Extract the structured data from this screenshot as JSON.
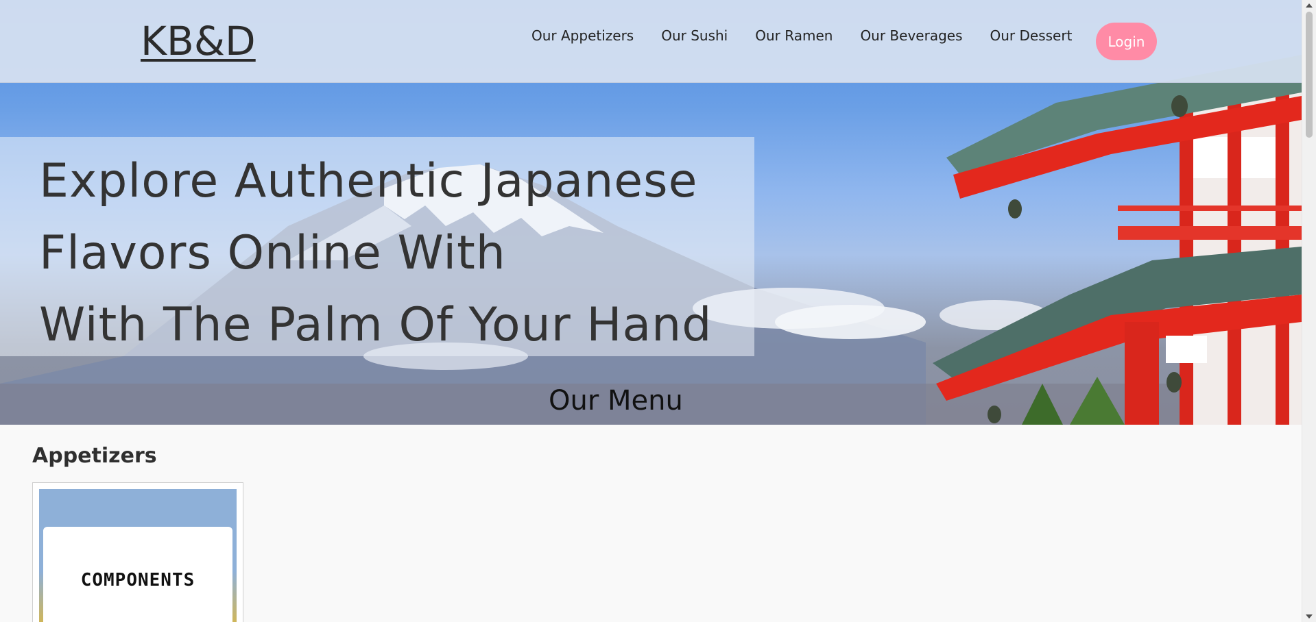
{
  "header": {
    "logo": "KB&D",
    "nav": [
      {
        "label": "Our Appetizers"
      },
      {
        "label": "Our Sushi"
      },
      {
        "label": "Our Ramen"
      },
      {
        "label": "Our Beverages"
      },
      {
        "label": "Our Dessert"
      }
    ],
    "login_label": "Login"
  },
  "hero": {
    "headline_lines": [
      "Explore Authentic Japanese",
      "Flavors Online With",
      "With The Palm Of Your Hand"
    ],
    "menu_heading": "Our Menu"
  },
  "content": {
    "section_title": "Appetizers",
    "cards": [
      {
        "label": "COMPONENTS"
      }
    ]
  },
  "colors": {
    "login_button": "#ff8ba6",
    "header_bg": "#d6e0f0",
    "pagoda_red": "#e02a1e",
    "sky_blue": "#4d8be0"
  }
}
